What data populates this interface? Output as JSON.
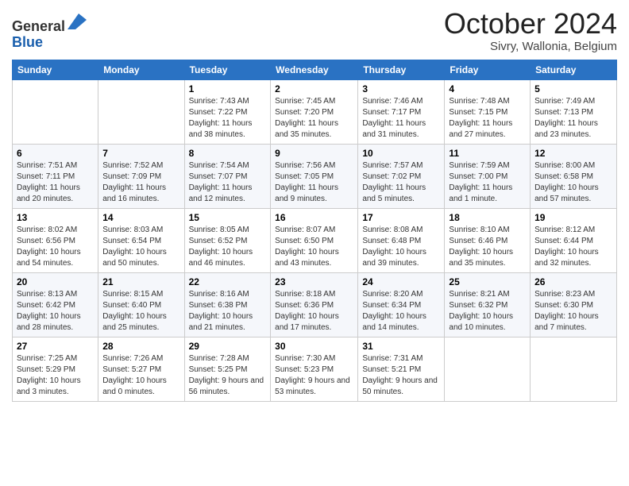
{
  "header": {
    "logo_line1": "General",
    "logo_line2": "Blue",
    "month_title": "October 2024",
    "location": "Sivry, Wallonia, Belgium"
  },
  "days_of_week": [
    "Sunday",
    "Monday",
    "Tuesday",
    "Wednesday",
    "Thursday",
    "Friday",
    "Saturday"
  ],
  "weeks": [
    [
      {
        "day": "",
        "sunrise": "",
        "sunset": "",
        "daylight": ""
      },
      {
        "day": "",
        "sunrise": "",
        "sunset": "",
        "daylight": ""
      },
      {
        "day": "1",
        "sunrise": "Sunrise: 7:43 AM",
        "sunset": "Sunset: 7:22 PM",
        "daylight": "Daylight: 11 hours and 38 minutes."
      },
      {
        "day": "2",
        "sunrise": "Sunrise: 7:45 AM",
        "sunset": "Sunset: 7:20 PM",
        "daylight": "Daylight: 11 hours and 35 minutes."
      },
      {
        "day": "3",
        "sunrise": "Sunrise: 7:46 AM",
        "sunset": "Sunset: 7:17 PM",
        "daylight": "Daylight: 11 hours and 31 minutes."
      },
      {
        "day": "4",
        "sunrise": "Sunrise: 7:48 AM",
        "sunset": "Sunset: 7:15 PM",
        "daylight": "Daylight: 11 hours and 27 minutes."
      },
      {
        "day": "5",
        "sunrise": "Sunrise: 7:49 AM",
        "sunset": "Sunset: 7:13 PM",
        "daylight": "Daylight: 11 hours and 23 minutes."
      }
    ],
    [
      {
        "day": "6",
        "sunrise": "Sunrise: 7:51 AM",
        "sunset": "Sunset: 7:11 PM",
        "daylight": "Daylight: 11 hours and 20 minutes."
      },
      {
        "day": "7",
        "sunrise": "Sunrise: 7:52 AM",
        "sunset": "Sunset: 7:09 PM",
        "daylight": "Daylight: 11 hours and 16 minutes."
      },
      {
        "day": "8",
        "sunrise": "Sunrise: 7:54 AM",
        "sunset": "Sunset: 7:07 PM",
        "daylight": "Daylight: 11 hours and 12 minutes."
      },
      {
        "day": "9",
        "sunrise": "Sunrise: 7:56 AM",
        "sunset": "Sunset: 7:05 PM",
        "daylight": "Daylight: 11 hours and 9 minutes."
      },
      {
        "day": "10",
        "sunrise": "Sunrise: 7:57 AM",
        "sunset": "Sunset: 7:02 PM",
        "daylight": "Daylight: 11 hours and 5 minutes."
      },
      {
        "day": "11",
        "sunrise": "Sunrise: 7:59 AM",
        "sunset": "Sunset: 7:00 PM",
        "daylight": "Daylight: 11 hours and 1 minute."
      },
      {
        "day": "12",
        "sunrise": "Sunrise: 8:00 AM",
        "sunset": "Sunset: 6:58 PM",
        "daylight": "Daylight: 10 hours and 57 minutes."
      }
    ],
    [
      {
        "day": "13",
        "sunrise": "Sunrise: 8:02 AM",
        "sunset": "Sunset: 6:56 PM",
        "daylight": "Daylight: 10 hours and 54 minutes."
      },
      {
        "day": "14",
        "sunrise": "Sunrise: 8:03 AM",
        "sunset": "Sunset: 6:54 PM",
        "daylight": "Daylight: 10 hours and 50 minutes."
      },
      {
        "day": "15",
        "sunrise": "Sunrise: 8:05 AM",
        "sunset": "Sunset: 6:52 PM",
        "daylight": "Daylight: 10 hours and 46 minutes."
      },
      {
        "day": "16",
        "sunrise": "Sunrise: 8:07 AM",
        "sunset": "Sunset: 6:50 PM",
        "daylight": "Daylight: 10 hours and 43 minutes."
      },
      {
        "day": "17",
        "sunrise": "Sunrise: 8:08 AM",
        "sunset": "Sunset: 6:48 PM",
        "daylight": "Daylight: 10 hours and 39 minutes."
      },
      {
        "day": "18",
        "sunrise": "Sunrise: 8:10 AM",
        "sunset": "Sunset: 6:46 PM",
        "daylight": "Daylight: 10 hours and 35 minutes."
      },
      {
        "day": "19",
        "sunrise": "Sunrise: 8:12 AM",
        "sunset": "Sunset: 6:44 PM",
        "daylight": "Daylight: 10 hours and 32 minutes."
      }
    ],
    [
      {
        "day": "20",
        "sunrise": "Sunrise: 8:13 AM",
        "sunset": "Sunset: 6:42 PM",
        "daylight": "Daylight: 10 hours and 28 minutes."
      },
      {
        "day": "21",
        "sunrise": "Sunrise: 8:15 AM",
        "sunset": "Sunset: 6:40 PM",
        "daylight": "Daylight: 10 hours and 25 minutes."
      },
      {
        "day": "22",
        "sunrise": "Sunrise: 8:16 AM",
        "sunset": "Sunset: 6:38 PM",
        "daylight": "Daylight: 10 hours and 21 minutes."
      },
      {
        "day": "23",
        "sunrise": "Sunrise: 8:18 AM",
        "sunset": "Sunset: 6:36 PM",
        "daylight": "Daylight: 10 hours and 17 minutes."
      },
      {
        "day": "24",
        "sunrise": "Sunrise: 8:20 AM",
        "sunset": "Sunset: 6:34 PM",
        "daylight": "Daylight: 10 hours and 14 minutes."
      },
      {
        "day": "25",
        "sunrise": "Sunrise: 8:21 AM",
        "sunset": "Sunset: 6:32 PM",
        "daylight": "Daylight: 10 hours and 10 minutes."
      },
      {
        "day": "26",
        "sunrise": "Sunrise: 8:23 AM",
        "sunset": "Sunset: 6:30 PM",
        "daylight": "Daylight: 10 hours and 7 minutes."
      }
    ],
    [
      {
        "day": "27",
        "sunrise": "Sunrise: 7:25 AM",
        "sunset": "Sunset: 5:29 PM",
        "daylight": "Daylight: 10 hours and 3 minutes."
      },
      {
        "day": "28",
        "sunrise": "Sunrise: 7:26 AM",
        "sunset": "Sunset: 5:27 PM",
        "daylight": "Daylight: 10 hours and 0 minutes."
      },
      {
        "day": "29",
        "sunrise": "Sunrise: 7:28 AM",
        "sunset": "Sunset: 5:25 PM",
        "daylight": "Daylight: 9 hours and 56 minutes."
      },
      {
        "day": "30",
        "sunrise": "Sunrise: 7:30 AM",
        "sunset": "Sunset: 5:23 PM",
        "daylight": "Daylight: 9 hours and 53 minutes."
      },
      {
        "day": "31",
        "sunrise": "Sunrise: 7:31 AM",
        "sunset": "Sunset: 5:21 PM",
        "daylight": "Daylight: 9 hours and 50 minutes."
      },
      {
        "day": "",
        "sunrise": "",
        "sunset": "",
        "daylight": ""
      },
      {
        "day": "",
        "sunrise": "",
        "sunset": "",
        "daylight": ""
      }
    ]
  ]
}
